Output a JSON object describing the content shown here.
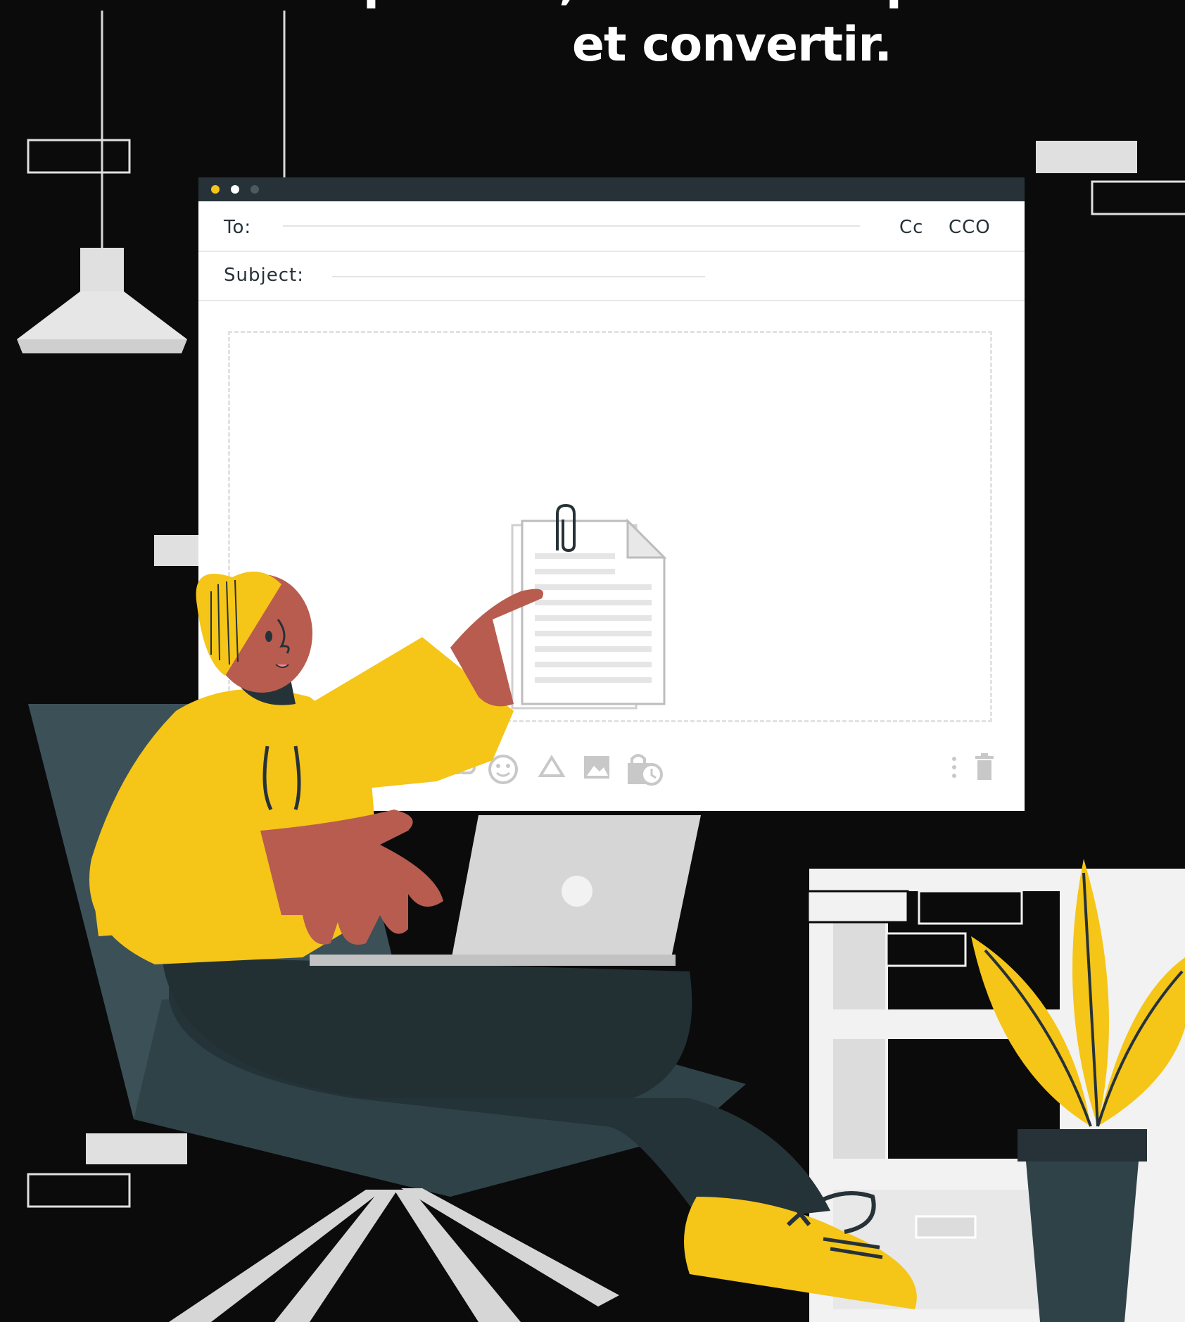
{
  "headline": {
    "line1": "optimisé, c'est la clé pour attirer",
    "line2": "et convertir."
  },
  "email": {
    "to_label": "To:",
    "cc_label": "Cc",
    "bcc_label": "CCO",
    "subject_label": "Subject:"
  },
  "colors": {
    "background": "#0b0b0b",
    "accent_yellow": "#f5c518",
    "dark_teal": "#263238",
    "skin": "#b85c4f",
    "light_gray": "#d6d6d6"
  },
  "toolbar_icons": [
    "attachment-icon",
    "link-icon",
    "emoji-icon",
    "drive-icon",
    "image-icon",
    "schedule-lock-icon",
    "more-options-icon",
    "trash-icon"
  ]
}
